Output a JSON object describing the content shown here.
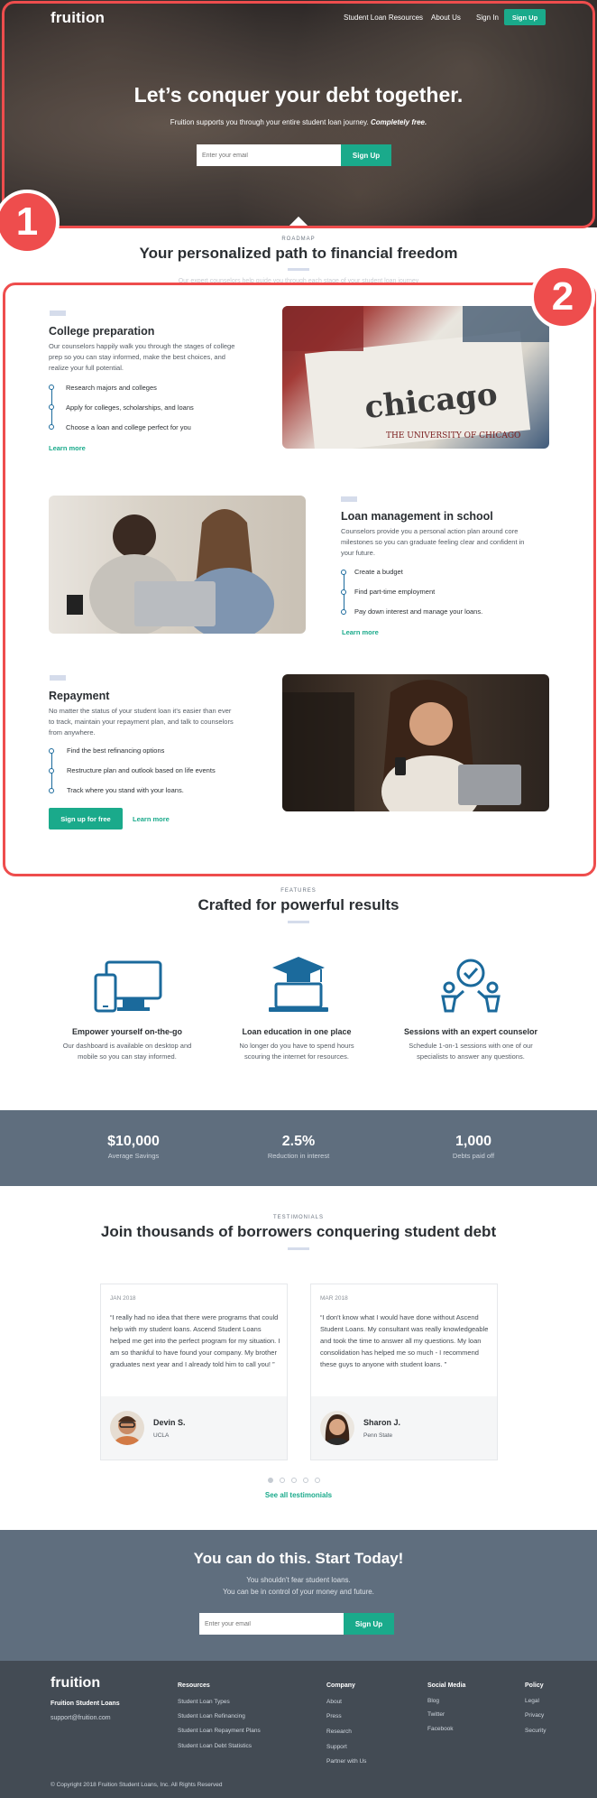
{
  "nav": {
    "logo": "fruition",
    "links": [
      "Student Loan Resources",
      "About Us",
      "Sign In"
    ],
    "signup": "Sign Up"
  },
  "hero": {
    "title": "Let’s conquer your debt together.",
    "subtitle": "Fruition supports you through your entire student loan journey.",
    "subtitle_em": "Completely free.",
    "email_placeholder": "Enter your email",
    "button": "Sign Up"
  },
  "annotations": [
    "1",
    "2"
  ],
  "roadmap": {
    "kicker": "ROADMAP",
    "title": "Your personalized path to financial freedom",
    "faint": "Our expert counselors help guide you through each stage of your student loan journey",
    "blocks": [
      {
        "title": "College preparation",
        "desc": "Our counselors happily walk you through the stages of college prep so you can stay informed, make the best choices, and realize your full potential.",
        "steps": [
          "Research majors and colleges",
          "Apply for colleges, scholarships, and loans",
          "Choose a loan and college perfect for you"
        ],
        "learn": "Learn more"
      },
      {
        "title": "Loan management in school",
        "desc": "Counselors provide you a personal action plan around core milestones so you can graduate feeling clear and confident in your future.",
        "steps": [
          "Create a budget",
          "Find part-time employment",
          "Pay down interest and manage your loans."
        ],
        "learn": "Learn more"
      },
      {
        "title": "Repayment",
        "desc": "No matter the status of your student loan it's easier than ever to track, maintain your repayment plan, and talk to counselors from anywhere.",
        "steps": [
          "Find the best refinancing options",
          "Restructure plan and outlook based on life events",
          "Track where you stand with your loans."
        ],
        "signup": "Sign up for free",
        "learn": "Learn more"
      }
    ],
    "photo_text": "THE UNIVERSITY OF CHICAGO"
  },
  "features": {
    "kicker": "FEATURES",
    "title": "Crafted for powerful results",
    "items": [
      {
        "icon": "devices-icon",
        "title": "Empower yourself on-the-go",
        "desc": "Our dashboard is available on desktop and mobile so you can stay informed."
      },
      {
        "icon": "graduation-laptop-icon",
        "title": "Loan education in one place",
        "desc": "No longer do you have to spend hours scouring the internet for resources."
      },
      {
        "icon": "counselor-session-icon",
        "title": "Sessions with an expert counselor",
        "desc": "Schedule 1-on-1 sessions with one of our specialists to answer any questions."
      }
    ]
  },
  "stats": [
    {
      "value": "$10,000",
      "label": "Average Savings"
    },
    {
      "value": "2.5%",
      "label": "Reduction in interest"
    },
    {
      "value": "1,000",
      "label": "Debts paid off"
    }
  ],
  "testimonials": {
    "kicker": "TESTIMONIALS",
    "title": "Join thousands of borrowers conquering student debt",
    "items": [
      {
        "date": "JAN 2018",
        "quote": "“I really had no idea that there were programs that could help with my student loans. Ascend Student Loans helped me get into the perfect program for my situation. I am so thankful to have found your company. My brother graduates next year and I already told him to call you! ”",
        "name": "Devin S.",
        "school": "UCLA"
      },
      {
        "date": "MAR 2018",
        "quote": "“I don't know what I would have done without Ascend Student Loans. My consultant was really knowledgeable and took the time to answer all my questions. My loan consolidation has helped me so much - I recommend these guys to anyone with student loans. ”",
        "name": "Sharon J.",
        "school": "Penn State"
      }
    ],
    "see_all": "See all testimonials"
  },
  "cta": {
    "title": "You can do this. Start Today!",
    "line1": "You shouldn't fear student loans.",
    "line2": "You can be in control of your money and future.",
    "email_placeholder": "Enter your email",
    "button": "Sign Up"
  },
  "footer": {
    "logo": "fruition",
    "brand": "Fruition Student Loans",
    "email": "support@fruition.com",
    "columns": [
      {
        "heading": "Resources",
        "links": [
          "Student Loan Types",
          "Student Loan Refinancing",
          "Student Loan Repayment Plans",
          "Student Loan Debt Statistics"
        ]
      },
      {
        "heading": "Company",
        "links": [
          "About",
          "Press",
          "Research",
          "Support",
          "Partner with Us"
        ]
      },
      {
        "heading": "Social Media",
        "links": [
          "Blog",
          "Twitter",
          "Facebook"
        ]
      },
      {
        "heading": "Policy",
        "links": [
          "Legal",
          "Privacy",
          "Security"
        ]
      }
    ],
    "copyright": "Copyright 2018 Fruition Student Loans, Inc. All Rights Reserved"
  },
  "colors": {
    "accent": "#1aaa8b",
    "annotation": "#ee4d4d",
    "slate": "#5f6e7e",
    "footer": "#434b54",
    "icon": "#1b6a9c"
  }
}
